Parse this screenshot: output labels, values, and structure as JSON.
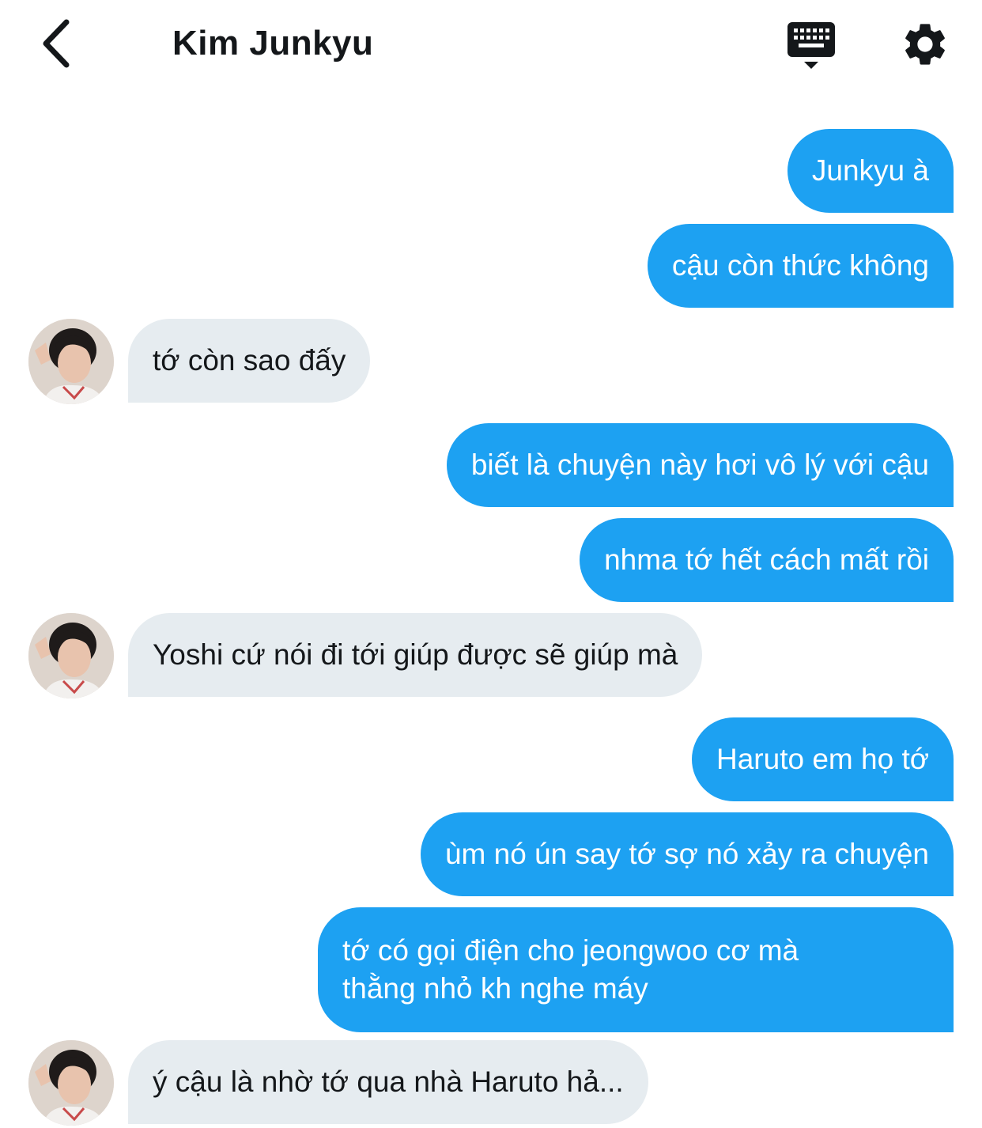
{
  "header": {
    "contact_name": "Kim Junkyu"
  },
  "icons": {
    "back": "chevron-left-icon",
    "keyboard": "keyboard-icon",
    "settings": "gear-icon"
  },
  "colors": {
    "outgoing_bubble": "#1da1f2",
    "incoming_bubble": "#e6ecf0",
    "text_dark": "#14171a"
  },
  "messages": [
    {
      "direction": "out",
      "text": "Junkyu à"
    },
    {
      "direction": "out",
      "text": "cậu còn thức không"
    },
    {
      "direction": "in",
      "text": "tớ còn sao đấy"
    },
    {
      "direction": "out",
      "text": "biết là chuyện này hơi vô lý với cậu"
    },
    {
      "direction": "out",
      "text": "nhma tớ hết cách mất rồi"
    },
    {
      "direction": "in",
      "text": "Yoshi cứ nói đi tới giúp được sẽ giúp mà"
    },
    {
      "direction": "out",
      "text": "Haruto em họ tớ"
    },
    {
      "direction": "out",
      "text": "ùm nó ún say tớ sợ nó xảy ra chuyện"
    },
    {
      "direction": "out",
      "lines": [
        "tớ có gọi điện cho jeongwoo cơ mà",
        "thằng nhỏ kh nghe máy"
      ]
    },
    {
      "direction": "in",
      "text": "ý cậu là nhờ tớ qua nhà Haruto hả..."
    }
  ]
}
